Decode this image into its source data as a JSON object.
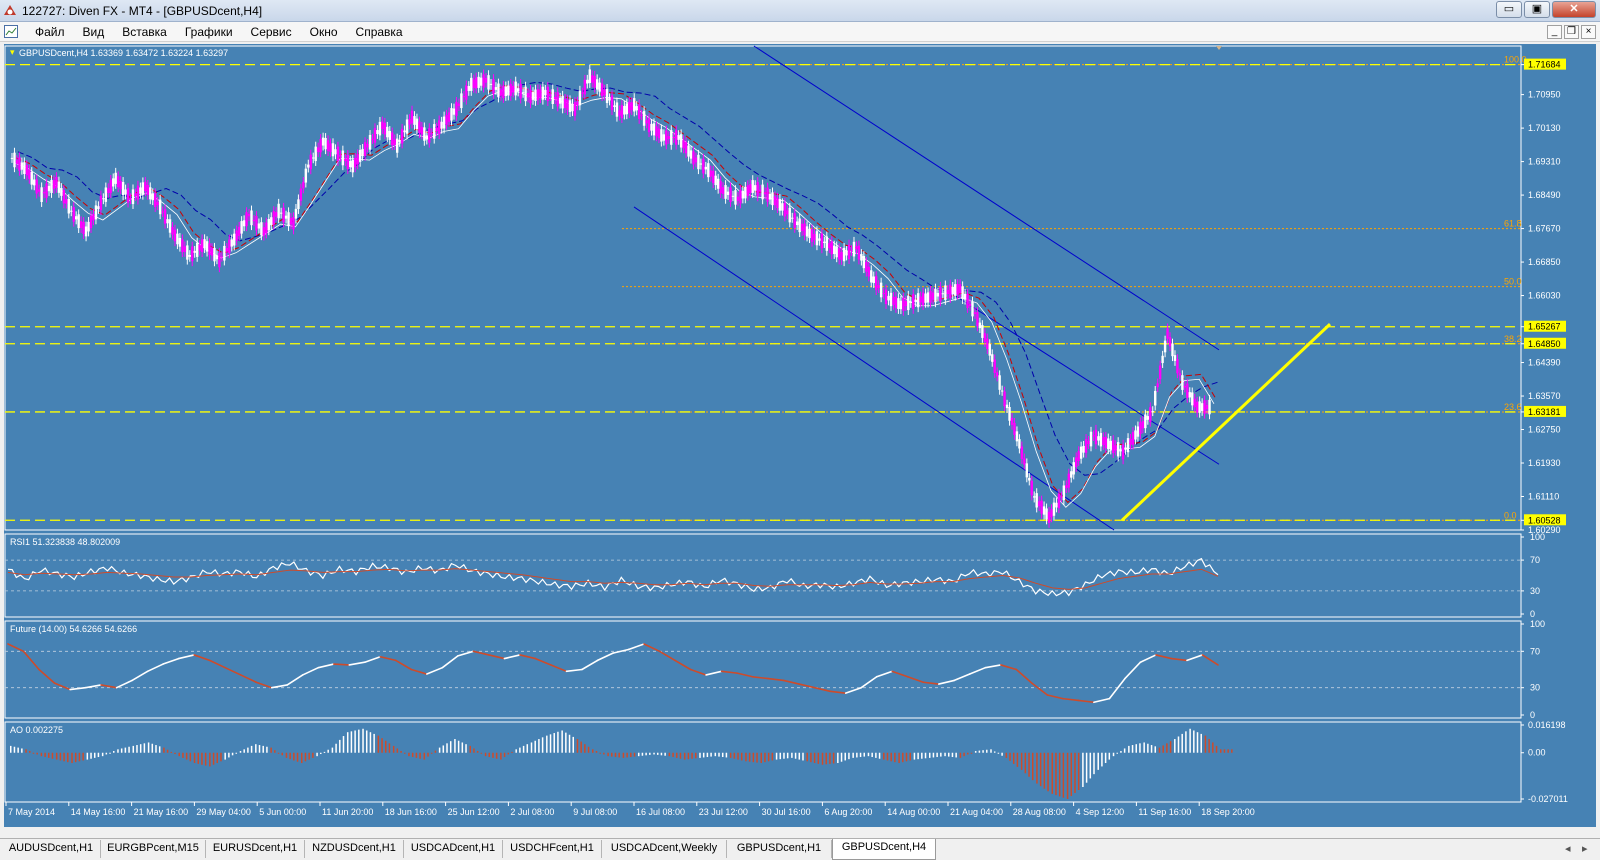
{
  "window": {
    "title": "122727: Diven FX - MT4 - [GBPUSDcent,H4]",
    "buttons": {
      "minimize": "▭",
      "maximize": "▣",
      "close": "✕"
    }
  },
  "menu": {
    "items": [
      "Файл",
      "Вид",
      "Вставка",
      "Графики",
      "Сервис",
      "Окно",
      "Справка"
    ],
    "mdi_buttons": [
      "_",
      "❐",
      "×"
    ]
  },
  "chart": {
    "header": "GBPUSDcent,H4  1.63369 1.63472 1.63224 1.63297",
    "symbol": "GBPUSDcent",
    "timeframe": "H4",
    "quote": {
      "open": 1.63369,
      "high": 1.63472,
      "low": 1.63224,
      "close": 1.63297
    }
  },
  "chart_data": [
    {
      "type": "line",
      "title": "GBPUSDcent,H4  1.63369 1.63472 1.63224 1.63297",
      "ylim": [
        1.6029,
        1.7214
      ],
      "y_ticks": [
        "1.71684",
        "1.70950",
        "1.70130",
        "1.69310",
        "1.68490",
        "1.67670",
        "1.66850",
        "1.66030",
        "1.65267",
        "1.64850",
        "1.64390",
        "1.63570",
        "1.63181",
        "1.62750",
        "1.61930",
        "1.61110",
        "1.60528",
        "1.60290"
      ],
      "highlighted_labels": [
        "1.71684",
        "1.65267",
        "1.64850",
        "1.63181",
        "1.60528"
      ],
      "fib_levels": [
        {
          "label": "100.0",
          "price": 1.71684
        },
        {
          "label": "61.8",
          "price": 1.6767
        },
        {
          "label": "50.0",
          "price": 1.6625
        },
        {
          "label": "38.2",
          "price": 1.6485
        },
        {
          "label": "23.6",
          "price": 1.6318
        },
        {
          "label": "0.0",
          "price": 1.60528
        }
      ],
      "horizontal_levels": [
        1.71684,
        1.65267,
        1.6485,
        1.63181,
        1.60528
      ],
      "x_ticks": [
        "7 May 2014",
        "14 May 16:00",
        "21 May 16:00",
        "29 May 04:00",
        "5 Jun 00:00",
        "11 Jun 20:00",
        "18 Jun 16:00",
        "25 Jun 12:00",
        "2 Jul 08:00",
        "9 Jul 08:00",
        "16 Jul 08:00",
        "23 Jul 12:00",
        "30 Jul 16:00",
        "6 Aug 20:00",
        "14 Aug 00:00",
        "21 Aug 04:00",
        "28 Aug 08:00",
        "4 Sep 12:00",
        "11 Sep 16:00",
        "18 Sep 20:00"
      ],
      "series": [
        {
          "values": [
            1.694,
            1.691,
            1.685,
            1.688,
            1.681,
            1.676,
            1.683,
            1.689,
            1.684,
            1.687,
            1.682,
            1.675,
            1.67,
            1.673,
            1.669,
            1.674,
            1.68,
            1.676,
            1.681,
            1.678,
            1.692,
            1.698,
            1.695,
            1.692,
            1.697,
            1.702,
            1.697,
            1.704,
            1.699,
            1.702,
            1.706,
            1.712,
            1.713,
            1.71,
            1.711,
            1.709,
            1.71,
            1.708,
            1.706,
            1.714,
            1.71,
            1.705,
            1.707,
            1.702,
            1.699,
            1.699,
            1.694,
            1.691,
            1.686,
            1.684,
            1.687,
            1.685,
            1.682,
            1.678,
            1.675,
            1.673,
            1.67,
            1.672,
            1.665,
            1.66,
            1.658,
            1.659,
            1.66,
            1.661,
            1.662,
            1.656,
            1.647,
            1.635,
            1.624,
            1.611,
            1.606,
            1.612,
            1.621,
            1.626,
            1.624,
            1.622,
            1.627,
            1.632,
            1.651,
            1.639,
            1.633,
            1.633
          ]
        }
      ]
    },
    {
      "type": "line",
      "title": "RSI1 51.323838 48.802009",
      "ylim": [
        0,
        100
      ],
      "y_ticks": [
        "100",
        "70",
        "30",
        "0"
      ],
      "series": [
        {
          "name": "RSI1",
          "values": [
            58,
            45,
            57,
            52,
            48,
            55,
            60,
            53,
            50,
            45,
            42,
            47,
            55,
            52,
            55,
            48,
            60,
            66,
            56,
            50,
            58,
            55,
            62,
            60,
            54,
            60,
            56,
            64,
            56,
            52,
            48,
            46,
            42,
            38,
            36,
            40,
            35,
            44,
            36,
            34,
            38,
            42,
            35,
            44,
            39,
            32,
            34,
            44,
            36,
            38,
            35,
            40,
            46,
            37,
            40,
            42,
            45,
            42,
            54,
            52,
            55,
            42,
            30,
            26,
            28,
            38,
            50,
            55,
            54,
            58,
            52,
            62,
            70,
            51
          ]
        },
        {
          "name": "Signal",
          "values": [
            54,
            51,
            53,
            52,
            51,
            52,
            54,
            53,
            52,
            50,
            48,
            48,
            50,
            51,
            52,
            51,
            54,
            57,
            56,
            54,
            55,
            55,
            57,
            58,
            56,
            57,
            57,
            59,
            57,
            55,
            53,
            51,
            48,
            45,
            42,
            42,
            40,
            41,
            40,
            38,
            38,
            40,
            38,
            40,
            40,
            37,
            36,
            38,
            38,
            38,
            37,
            38,
            41,
            39,
            39,
            40,
            42,
            42,
            46,
            48,
            50,
            47,
            40,
            34,
            32,
            34,
            40,
            46,
            49,
            52,
            52,
            55,
            58,
            49
          ]
        }
      ]
    },
    {
      "type": "line",
      "title": "Future (14.00) 54.6266 54.6266",
      "ylim": [
        0,
        100
      ],
      "y_ticks": [
        "100",
        "70",
        "30",
        "0"
      ],
      "series": [
        {
          "name": "Future (14.00)",
          "values": [
            78,
            70,
            50,
            35,
            28,
            30,
            33,
            30,
            38,
            48,
            56,
            62,
            66,
            60,
            52,
            44,
            36,
            30,
            33,
            44,
            52,
            56,
            55,
            58,
            64,
            60,
            50,
            45,
            52,
            65,
            70,
            66,
            62,
            66,
            62,
            55,
            48,
            50,
            60,
            68,
            72,
            78,
            70,
            60,
            50,
            44,
            48,
            46,
            42,
            40,
            38,
            34,
            30,
            26,
            24,
            30,
            42,
            48,
            42,
            36,
            34,
            38,
            45,
            52,
            55,
            50,
            35,
            22,
            18,
            16,
            14,
            18,
            40,
            58,
            66,
            62,
            60,
            66,
            55
          ]
        }
      ]
    },
    {
      "type": "bar",
      "title": "AO 0.002275",
      "ylim": [
        -0.027011,
        0.016198
      ],
      "y_ticks": [
        "0.016198",
        "0.00",
        "-0.027011"
      ],
      "series": [
        {
          "name": "AO",
          "values": [
            0.004,
            0.002,
            -0.002,
            -0.004,
            -0.006,
            -0.004,
            -0.002,
            0.002,
            0.004,
            0.006,
            0.003,
            -0.002,
            -0.006,
            -0.008,
            -0.004,
            0.001,
            0.005,
            0.003,
            -0.003,
            -0.006,
            -0.002,
            0.003,
            0.012,
            0.014,
            0.01,
            0.004,
            -0.002,
            -0.004,
            0.003,
            0.008,
            0.004,
            -0.002,
            -0.004,
            0.002,
            0.006,
            0.01,
            0.013,
            0.008,
            0.002,
            -0.002,
            -0.003,
            -0.002,
            -0.001,
            -0.002,
            -0.004,
            -0.003,
            -0.002,
            -0.003,
            -0.005,
            -0.006,
            -0.004,
            -0.003,
            -0.005,
            -0.007,
            -0.006,
            -0.003,
            -0.002,
            -0.004,
            -0.006,
            -0.004,
            -0.003,
            -0.002,
            -0.003,
            0.001,
            0.002,
            -0.003,
            -0.01,
            -0.018,
            -0.024,
            -0.027,
            -0.02,
            -0.01,
            -0.002,
            0.004,
            0.006,
            0.003,
            0.008,
            0.014,
            0.01,
            0.002
          ]
        }
      ]
    }
  ],
  "tabs": [
    {
      "label": "AUDUSDcent,H1",
      "active": false
    },
    {
      "label": "EURGBPcent,M15",
      "active": false
    },
    {
      "label": "EURUSDcent,H1",
      "active": false
    },
    {
      "label": "NZDUSDcent,H1",
      "active": false
    },
    {
      "label": "USDCADcent,H1",
      "active": false
    },
    {
      "label": "USDCHFcent,H1",
      "active": false
    },
    {
      "label": "USDCADcent,Weekly",
      "active": false
    },
    {
      "label": "GBPUSDcent,H1",
      "active": false
    },
    {
      "label": "GBPUSDcent,H4",
      "active": true
    }
  ],
  "tab_nav": {
    "prev": "◂",
    "next": "▸"
  },
  "colors": {
    "chart_bg": "#4682b4",
    "candle_up": "#ffffff",
    "candle_down": "#ff00ff",
    "level_line": "#ffff00",
    "fib_line": "#ffa500",
    "trendline": "#ffff00",
    "channel": "#0000cd",
    "ma_red": "#cc0000",
    "ma_blue": "#0000aa",
    "indicator_signal": "#cd4b2b"
  }
}
